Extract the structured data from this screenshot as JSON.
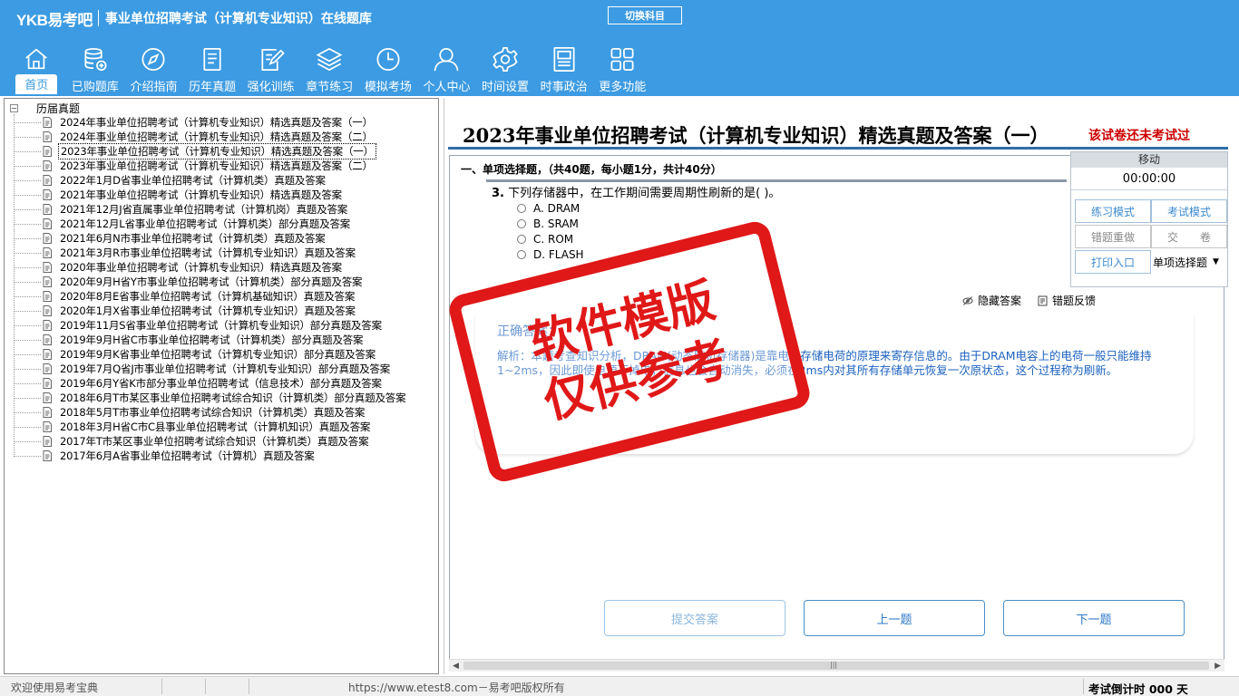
{
  "header": {
    "logo": "YKB易考吧",
    "title": "事业单位招聘考试（计算机专业知识）在线题库",
    "switch_subject": "切换科目"
  },
  "nav": [
    {
      "label": "首页",
      "icon": "home-icon"
    },
    {
      "label": "已购题库",
      "icon": "database-icon"
    },
    {
      "label": "介绍指南",
      "icon": "compass-icon"
    },
    {
      "label": "历年真题",
      "icon": "document-list-icon"
    },
    {
      "label": "强化训练",
      "icon": "edit-icon"
    },
    {
      "label": "章节练习",
      "icon": "layers-icon"
    },
    {
      "label": "模拟考场",
      "icon": "clock-icon"
    },
    {
      "label": "个人中心",
      "icon": "user-icon"
    },
    {
      "label": "时间设置",
      "icon": "gear-icon"
    },
    {
      "label": "时事政治",
      "icon": "newspaper-icon"
    },
    {
      "label": "更多功能",
      "icon": "grid-icon"
    }
  ],
  "tree": {
    "root": "历届真题",
    "items": [
      "2024年事业单位招聘考试（计算机专业知识）精选真题及答案（一）",
      "2024年事业单位招聘考试（计算机专业知识）精选真题及答案（二）",
      "2023年事业单位招聘考试（计算机专业知识）精选真题及答案（一）",
      "2023年事业单位招聘考试（计算机专业知识）精选真题及答案（二）",
      "2022年1月D省事业单位招聘考试（计算机类）真题及答案",
      "2021年事业单位招聘考试（计算机专业知识）精选真题及答案",
      "2021年12月J省直属事业单位招聘考试（计算机岗）真题及答案",
      "2021年12月L省事业单位招聘考试（计算机类）部分真题及答案",
      "2021年6月N市事业单位招聘考试（计算机类）真题及答案",
      "2021年3月R市事业单位招聘考试（计算机专业知识）真题及答案",
      "2020年事业单位招聘考试（计算机专业知识）精选真题及答案",
      "2020年9月H省Y市事业单位招聘考试（计算机类）部分真题及答案",
      "2020年8月E省事业单位招聘考试（计算机基础知识）真题及答案",
      "2020年1月X省事业单位招聘考试（计算机专业知识）真题及答案",
      "2019年11月S省事业单位招聘考试（计算机专业知识）部分真题及答案",
      "2019年9月H省C市事业单位招聘考试（计算机类）部分真题及答案",
      "2019年9月K省事业单位招聘考试（计算机专业知识）部分真题及答案",
      "2019年7月Q省J市事业单位招聘考试（计算机专业知识）部分真题及答案",
      "2019年6月Y省K市部分事业单位招聘考试（信息技术）部分真题及答案",
      "2018年6月T市某区事业单位招聘考试综合知识（计算机类）部分真题及答案",
      "2018年5月T市事业单位招聘考试综合知识（计算机类）真题及答案",
      "2018年3月H省C市C县事业单位招聘考试（计算机知识）真题及答案",
      "2017年T市某区事业单位招聘考试综合知识（计算机类）真题及答案",
      "2017年6月A省事业单位招聘考试（计算机）真题及答案"
    ],
    "selected_index": 2
  },
  "exam": {
    "title": "2023年事业单位招聘考试（计算机专业知识）精选真题及答案（一）",
    "status": "该试卷还未考试过",
    "section": "一、单项选择题，（共40题，每小题1分，共计40分）",
    "question_number": "3.",
    "question_text": "下列存储器中，在工作期间需要周期性刷新的是(  )。",
    "options": [
      "A. DRAM",
      "B. SRAM",
      "C. ROM",
      "D. FLASH"
    ],
    "hide_answer": "隐藏答案",
    "feedback": "错题反馈",
    "correct_label": "正确答案：",
    "explanation": "解析：本题考查知识分析，DRAM(动态随机存储器)是靠电容存储电荷的原理来寄存信息的。由于DRAM电容上的电荷一般只能维持1~2ms，因此即使电源不掉电，信息也会自动消失，必须在2ms内对其所有存储单元恢复一次原状态，这个过程称为刷新。",
    "submit_answer": "提交答案",
    "prev": "上一题",
    "next": "下一题"
  },
  "control": {
    "title": "移动",
    "timer": "00:00:00",
    "practice_mode": "练习模式",
    "exam_mode": "考试模式",
    "redo_wrong": "错题重做",
    "submit_paper": "交　　卷",
    "print_entry": "打印入口",
    "question_type": "单项选择题"
  },
  "watermark": {
    "line1": "软件模版",
    "line2": "仅供参考"
  },
  "status_bar": {
    "welcome": "欢迎使用易考宝典",
    "copyright": "https://www.etest8.com－易考吧版权所有",
    "countdown": "考试倒计时 000 天"
  },
  "colors": {
    "header_bg": "#3c9be2",
    "accent_red": "#e01818",
    "link_blue": "#1c62c0"
  }
}
